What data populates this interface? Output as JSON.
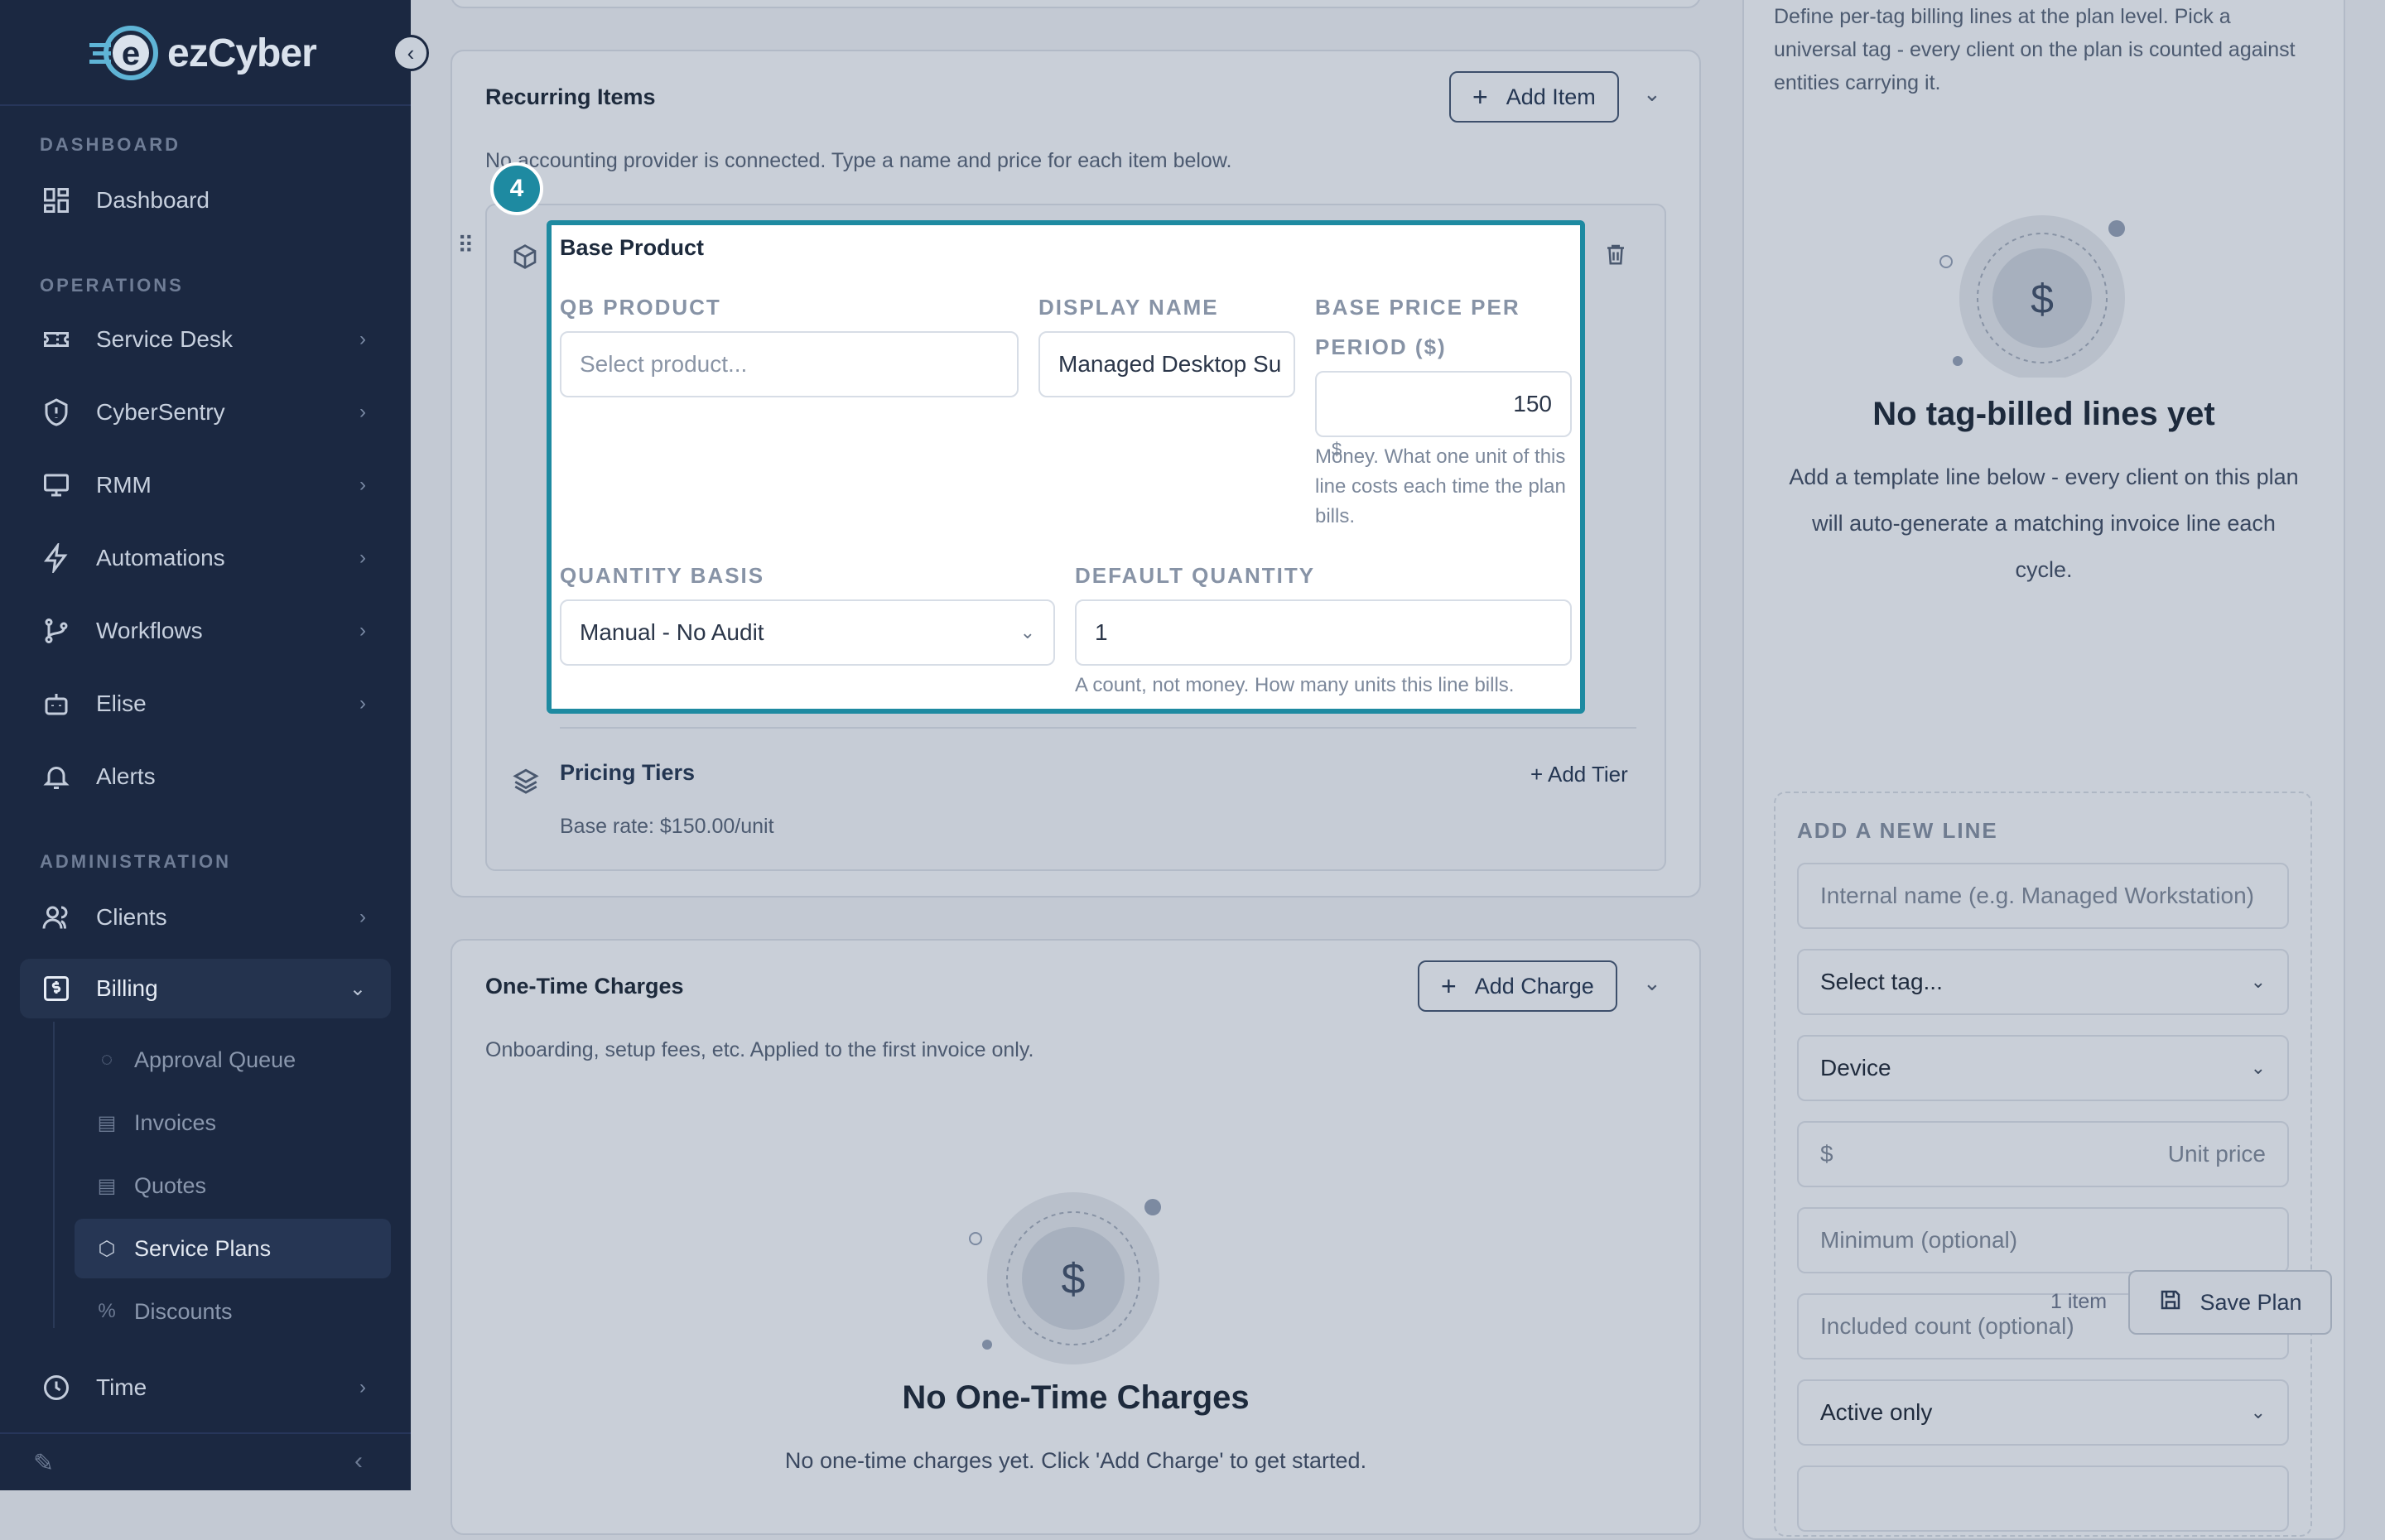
{
  "brand": {
    "name": "ezCyber"
  },
  "sidebar": {
    "sections": {
      "dashboard": "DASHBOARD",
      "operations": "OPERATIONS",
      "administration": "ADMINISTRATION"
    },
    "items": [
      {
        "label": "Dashboard",
        "icon": "grid-icon"
      },
      {
        "label": "Service Desk",
        "icon": "ticket-icon"
      },
      {
        "label": "CyberSentry",
        "icon": "shield-icon"
      },
      {
        "label": "RMM",
        "icon": "monitor-icon"
      },
      {
        "label": "Automations",
        "icon": "lightning-icon"
      },
      {
        "label": "Workflows",
        "icon": "git-branch-icon"
      },
      {
        "label": "Elise",
        "icon": "bot-icon"
      },
      {
        "label": "Alerts",
        "icon": "bell-icon"
      },
      {
        "label": "Clients",
        "icon": "users-icon"
      },
      {
        "label": "Billing",
        "icon": "receipt-dollar-icon"
      },
      {
        "label": "Time",
        "icon": "clock-icon"
      }
    ],
    "billing_sub": [
      {
        "label": "Approval Queue",
        "icon": "check-circle-icon"
      },
      {
        "label": "Invoices",
        "icon": "document-icon"
      },
      {
        "label": "Quotes",
        "icon": "document-icon"
      },
      {
        "label": "Service Plans",
        "icon": "package-icon"
      },
      {
        "label": "Discounts",
        "icon": "percent-icon"
      }
    ]
  },
  "recurring": {
    "title": "Recurring Items",
    "add_label": "Add Item",
    "subtitle": "No accounting provider is connected. Type a name and price for each item below.",
    "step_number": "4",
    "item": {
      "title": "Base Product",
      "qb_label": "QB PRODUCT",
      "qb_placeholder": "Select product...",
      "display_label": "DISPLAY NAME",
      "display_value": "Managed Desktop Su",
      "price_label_1": "BASE PRICE PER",
      "price_label_2": "PERIOD ($)",
      "price_value": "150",
      "price_prefix": "$",
      "price_help": "Money. What one unit of this line costs each time the plan bills.",
      "qty_basis_label": "QUANTITY BASIS",
      "qty_basis_value": "Manual - No Audit",
      "default_qty_label": "DEFAULT QUANTITY",
      "default_qty_value": "1",
      "default_qty_help": "A count, not money. How many units this line bills."
    },
    "tiers": {
      "title": "Pricing Tiers",
      "add_label": "+ Add Tier",
      "base_rate": "Base rate: $150.00/unit"
    }
  },
  "onetime": {
    "title": "One-Time Charges",
    "add_label": "Add Charge",
    "subtitle": "Onboarding, setup fees, etc. Applied to the first invoice only.",
    "empty_title": "No One-Time Charges",
    "empty_text": "No one-time charges yet. Click 'Add Charge' to get started."
  },
  "tag_panel": {
    "intro": "Define per-tag billing lines at the plan level. Pick a universal tag - every client on the plan is counted against entities carrying it.",
    "empty_title": "No tag-billed lines yet",
    "empty_text": "Add a template line below - every client on this plan will auto-generate a matching invoice line each cycle.",
    "new_line_label": "ADD A NEW LINE",
    "name_placeholder": "Internal name (e.g. Managed Workstation)",
    "tag_select": "Select tag...",
    "entity_select": "Device",
    "unit_prefix": "$",
    "unit_placeholder": "Unit price",
    "min_placeholder": "Minimum (optional)",
    "included_placeholder": "Included count (optional)",
    "status_select": "Active only"
  },
  "footer_bar": {
    "items_count": "1 item",
    "save_label": "Save Plan"
  },
  "colors": {
    "sidebar_bg": "#1b2841",
    "accent": "#1e8aa1",
    "overlay_bg": "#c3c9d3"
  }
}
